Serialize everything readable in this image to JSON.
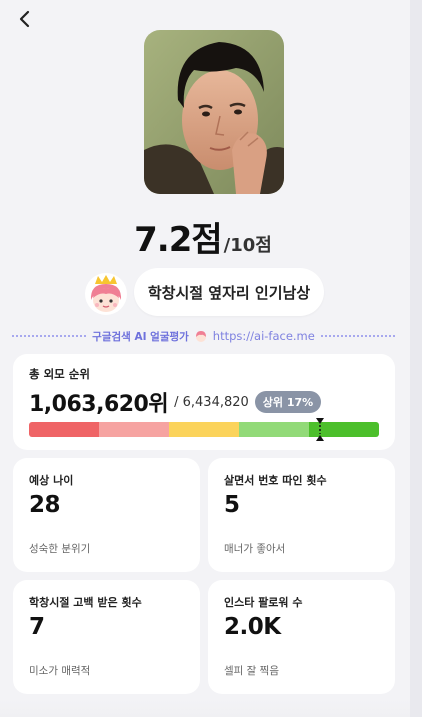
{
  "score": {
    "value": "7.2점",
    "max": "/10점"
  },
  "bubble_text": "학창시절 옆자리 인기남상",
  "divider": {
    "label": "구글검색 AI 얼굴평가",
    "url": "https://ai-face.me"
  },
  "rank": {
    "title": "총 외모 순위",
    "value": "1,063,620위",
    "total": "/ 6,434,820",
    "badge": "상위 17%",
    "percentile": 0.83,
    "bar_colors": [
      "#ef6466",
      "#f6a3a1",
      "#fbd35b",
      "#92da78",
      "#4cbf2b"
    ]
  },
  "stats": [
    {
      "label": "예상 나이",
      "value": "28",
      "note": "성숙한 분위기"
    },
    {
      "label": "살면서 번호 따인 횟수",
      "value": "5",
      "note": "매너가 좋아서"
    },
    {
      "label": "학창시절 고백 받은 횟수",
      "value": "7",
      "note": "미소가 매력적"
    },
    {
      "label": "인스타 팔로워 수",
      "value": "2.0K",
      "note": "셀피 잘 찍음"
    }
  ]
}
